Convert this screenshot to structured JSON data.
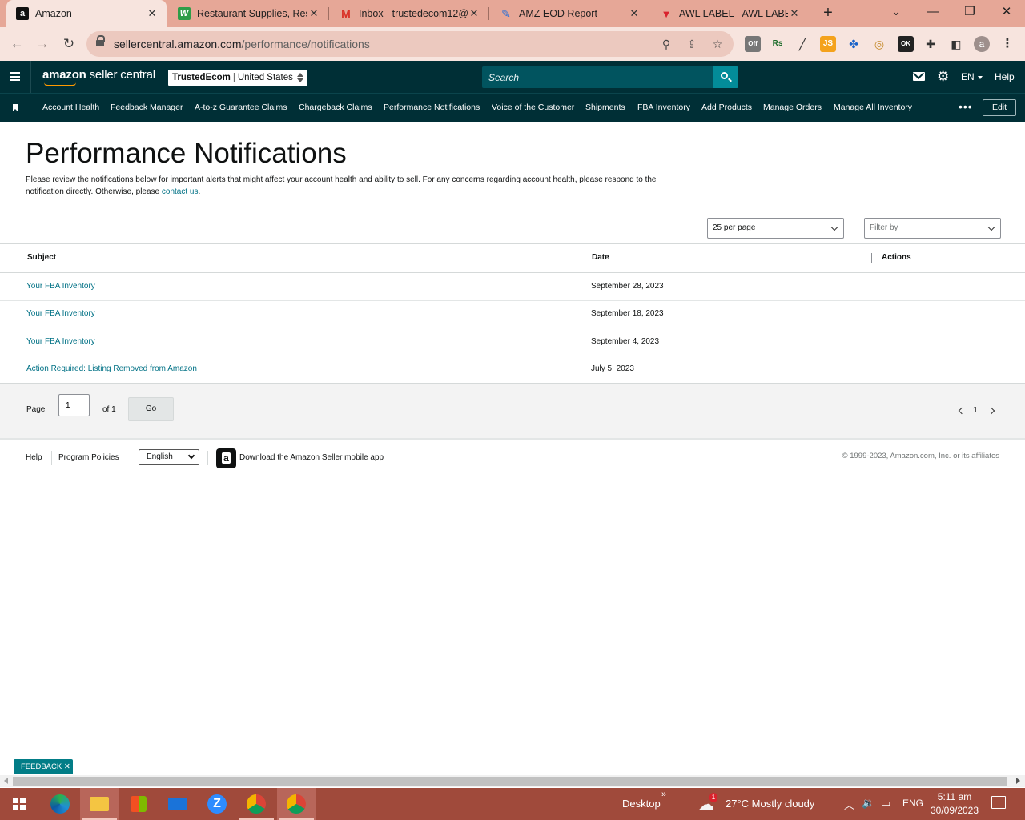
{
  "browser": {
    "tabs": [
      {
        "title": "Amazon",
        "favicon": "amazon-a",
        "active": true
      },
      {
        "title": "Restaurant Supplies, Rest",
        "favicon": "w-leaf"
      },
      {
        "title": "Inbox - trustedecom12@",
        "favicon": "gmail-m"
      },
      {
        "title": "AMZ EOD Report",
        "favicon": "pen"
      },
      {
        "title": "AWL LABEL - AWL LABEL",
        "favicon": "awl-v"
      }
    ],
    "url_host": "sellercentral.amazon.com",
    "url_path": "/performance/notifications",
    "ext_off_badge": "Off",
    "ext_ok_badge": "OK",
    "ext_js": "JS",
    "ext_rs": "Rs",
    "profile_initial": "a"
  },
  "header": {
    "logo_main": "amazon",
    "logo_sub": " seller central",
    "account_store": "TrustedEcom",
    "account_region": "United States",
    "search_placeholder": "Search",
    "language": "EN",
    "help": "Help"
  },
  "nav": {
    "items": [
      "Account Health",
      "Feedback Manager",
      "A-to-z Guarantee Claims",
      "Chargeback Claims",
      "Performance Notifications",
      "Voice of the Customer",
      "Shipments",
      "FBA Inventory",
      "Add Products",
      "Manage Orders",
      "Manage All Inventory"
    ],
    "more": "•••",
    "edit": "Edit"
  },
  "main": {
    "title": "Performance Notifications",
    "intro_text": "Please review the notifications below for important alerts that might affect your account health and ability to sell. For any concerns regarding account health, please respond to the notification directly. Otherwise, please ",
    "intro_link": "contact us",
    "intro_end": ".",
    "per_page": "25 per page",
    "filter_placeholder": "Filter by",
    "columns": {
      "subject": "Subject",
      "date": "Date",
      "actions": "Actions"
    },
    "rows": [
      {
        "subject": "Your FBA Inventory",
        "date": "September 28, 2023"
      },
      {
        "subject": "Your FBA Inventory",
        "date": "September 18, 2023"
      },
      {
        "subject": "Your FBA Inventory",
        "date": "September 4, 2023"
      },
      {
        "subject": "Action Required: Listing Removed from Amazon",
        "date": "July 5, 2023"
      }
    ],
    "pager": {
      "page_label": "Page",
      "page_value": "1",
      "of_label": "of 1",
      "go": "Go",
      "current": "1"
    }
  },
  "footer": {
    "help": "Help",
    "policies": "Program Policies",
    "language": "English",
    "app_text": "Download the Amazon Seller mobile app",
    "copyright": "© 1999-2023, Amazon.com, Inc. or its affiliates"
  },
  "feedback": "FEEDBACK",
  "taskbar": {
    "desktop": "Desktop",
    "weather_badge": "1",
    "weather": "27°C  Mostly cloudy",
    "lang": "ENG",
    "time": "5:11 am",
    "date": "30/09/2023"
  },
  "colors": {
    "header_bg": "#002f36",
    "link": "#007185",
    "search_btn": "#038c99",
    "taskbar": "#a04a3b",
    "tabstrip": "#e6a797"
  }
}
